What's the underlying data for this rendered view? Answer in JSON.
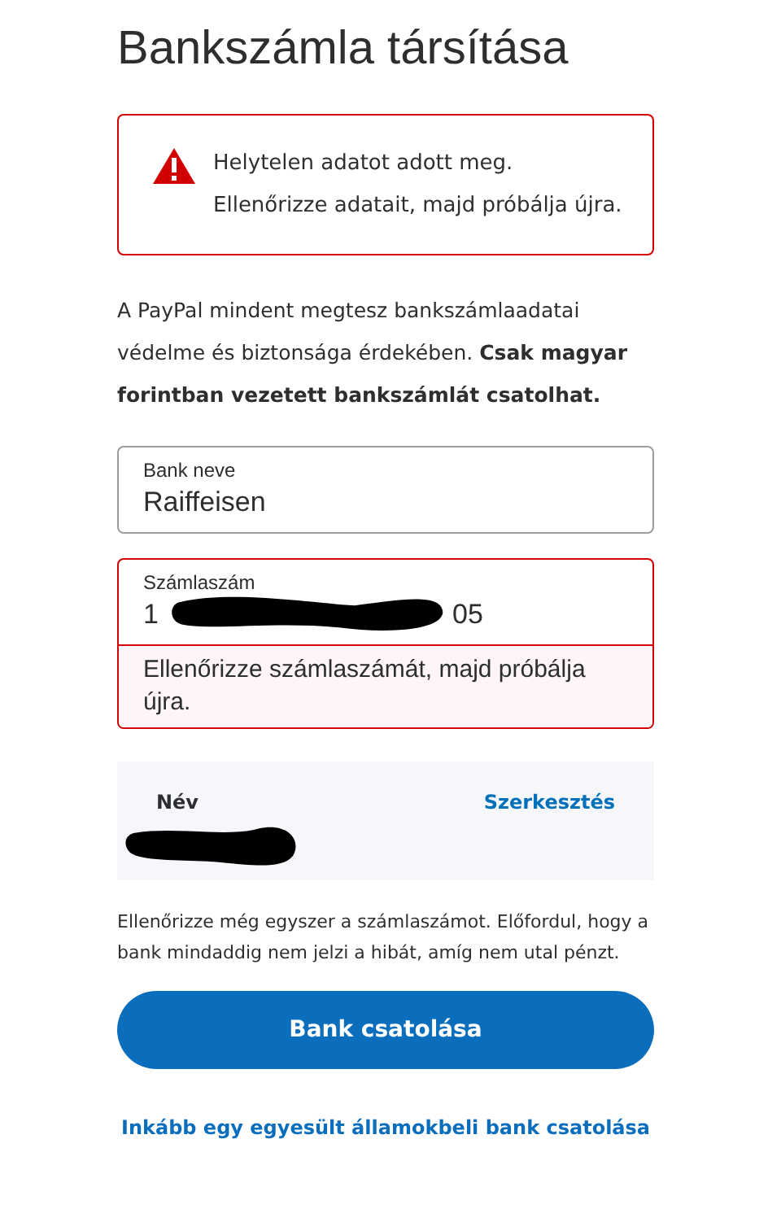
{
  "page": {
    "title": "Bankszámla társítása"
  },
  "alert": {
    "message": "Helytelen adatot adott meg. Ellenőrizze adatait, majd próbálja újra."
  },
  "intro": "A PayPal mindent megtesz bankszámlaadatai védelme és biztonsága érdekében. **Csak magyar forintban vezetett bankszámlát csatolhat.**",
  "fields": [
    {
      "kind": "plain",
      "label": "Bank neve",
      "value": "Raiffeisen",
      "error": false
    },
    {
      "kind": "redacted",
      "label": "Számlaszám",
      "value_start": "1",
      "value_end": "05",
      "error": true,
      "error_message": "Ellenőrizze számlaszámát, majd próbálja újra."
    }
  ],
  "name_card": {
    "label": "Név",
    "action": "Szerkesztés"
  },
  "note": "Ellenőrizze még egyszer a számlaszámot. Előfordul, hogy a bank mindaddig nem jelzi a hibát, amíg nem utal pénzt.",
  "primary_button": "Bank csatolása",
  "link": "Inkább egy egyesült államokbeli bank csatolása"
}
